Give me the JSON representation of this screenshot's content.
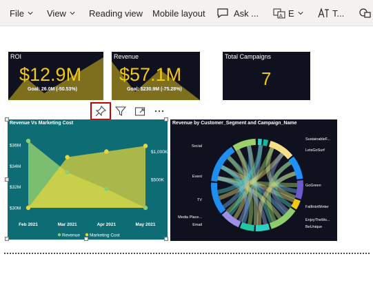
{
  "toolbar": {
    "file": "File",
    "view": "View",
    "reading_view": "Reading view",
    "mobile_layout": "Mobile layout",
    "ask": "Ask ...",
    "e_item": "E",
    "t_item": "T..."
  },
  "cards": {
    "roi": {
      "title": "ROI",
      "value": "$12.9M",
      "goal": "Goal: 26.0M (-50.53%)"
    },
    "revenue": {
      "title": "Revenue",
      "value": "$57.1M",
      "goal": "Goal: $230.9M (-75.28%)"
    },
    "campaigns": {
      "title": "Total Campaigns",
      "value": "7"
    }
  },
  "colors": {
    "card_bg": "#10111e",
    "accent": "#f2c811",
    "chart1_bg": "#0e6d74",
    "revenue_series": "#8fcc6e",
    "marketing_series": "#e6d63c",
    "pin_highlight": "#c00000"
  },
  "chart_data": [
    {
      "type": "area",
      "title": "Revenue Vs Marketing Cost",
      "categories": [
        "Feb 2021",
        "Mar 2021",
        "Apr 2021",
        "May 2021"
      ],
      "y_left_ticks": [
        "$36M",
        "$34M",
        "$32M",
        "$30M"
      ],
      "y_right_ticks": [
        "$1,000K",
        "$500K"
      ],
      "ylim_left": [
        30,
        37
      ],
      "ylim_right": [
        0,
        1300
      ],
      "series": [
        {
          "name": "Revenue",
          "axis": "left",
          "values": [
            36.4,
            33.4,
            31.8,
            30.0
          ]
        },
        {
          "name": "Marketing Cost",
          "axis": "right",
          "values": [
            0,
            900,
            1000,
            1100
          ]
        }
      ],
      "legend": "bottom"
    },
    {
      "type": "chord",
      "title": "Revenue by Customer_Segment and Campaign_Name",
      "left_labels": [
        "Social",
        "Event",
        "TV",
        "Media Place...",
        "Email"
      ],
      "right_labels": [
        "SustainableF...",
        "LetsGoSurf",
        "GoGreen",
        "FallIntoWinter",
        "EnjoyTheMo...",
        "BeUnique"
      ]
    }
  ],
  "icons": [
    "chevron-down-icon",
    "comment-icon",
    "translate-icon",
    "text-format-icon",
    "shapes-icon",
    "pin-icon",
    "filter-icon",
    "focus-mode-icon",
    "more-options-icon"
  ]
}
